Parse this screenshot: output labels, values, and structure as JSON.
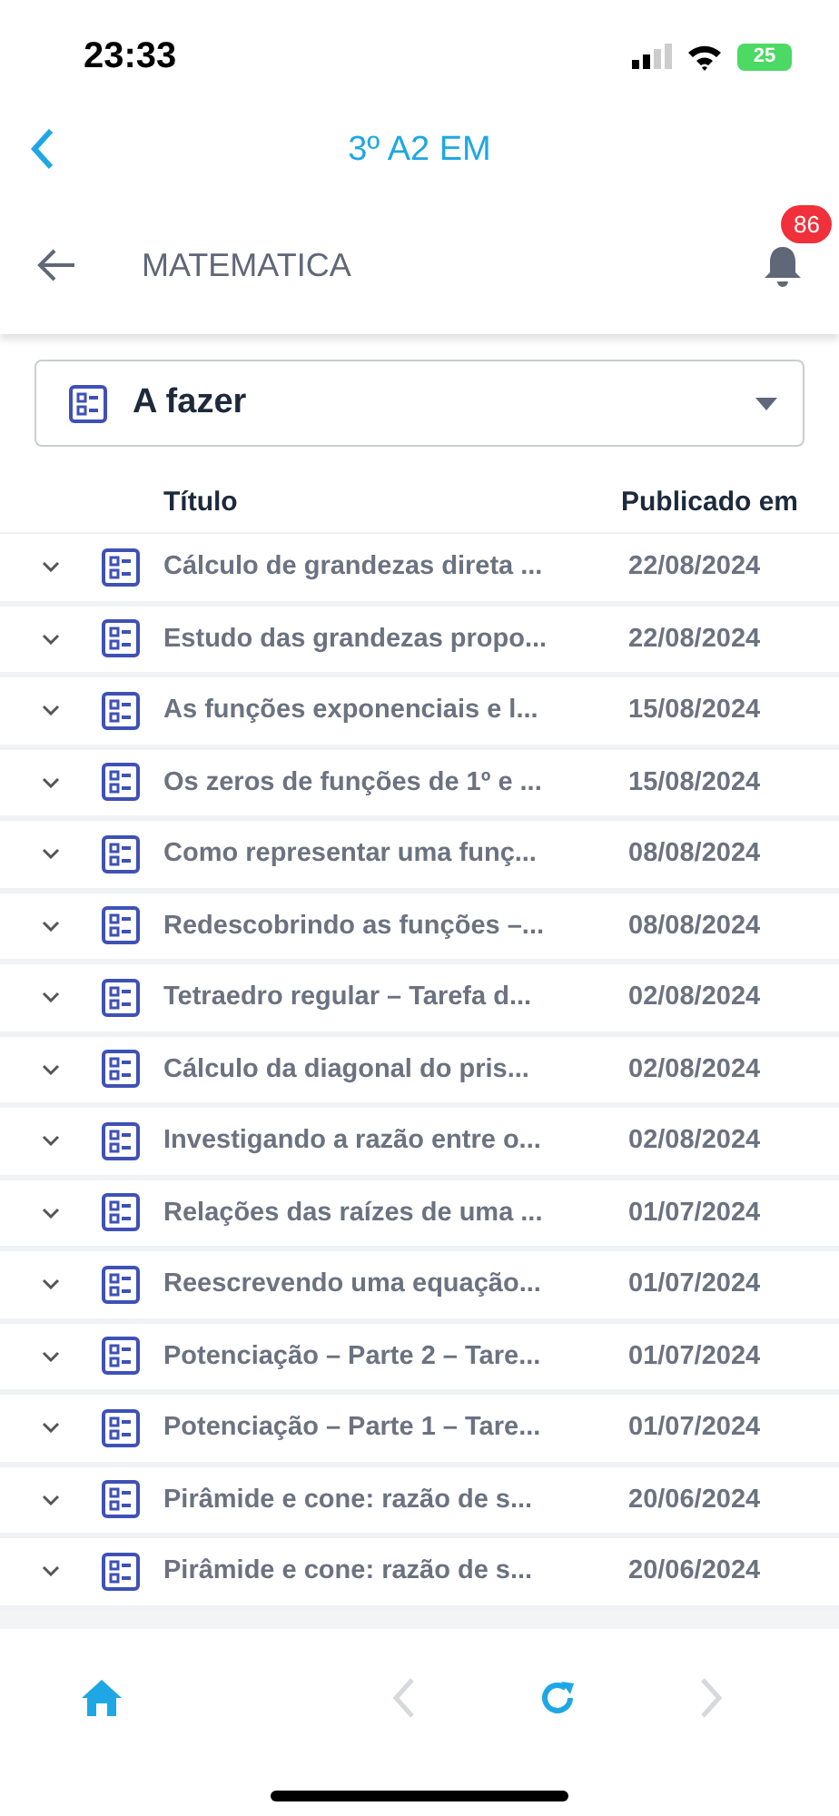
{
  "status_bar": {
    "time": "23:33",
    "battery": "25"
  },
  "top_bar": {
    "title": "3º A2 EM"
  },
  "header": {
    "title": "MATEMATICA",
    "notifications": "86"
  },
  "filter": {
    "value": "A fazer"
  },
  "table": {
    "columns": [
      "Título",
      "Publicado em"
    ],
    "rows": [
      {
        "title": "Cálculo de grandezas direta ...",
        "date": "22/08/2024"
      },
      {
        "title": "Estudo das grandezas propo...",
        "date": "22/08/2024"
      },
      {
        "title": "As funções exponenciais e l...",
        "date": "15/08/2024"
      },
      {
        "title": "Os zeros de funções de 1º e ...",
        "date": "15/08/2024"
      },
      {
        "title": "Como representar uma funç...",
        "date": "08/08/2024"
      },
      {
        "title": "Redescobrindo as funções –...",
        "date": "08/08/2024"
      },
      {
        "title": "Tetraedro regular – Tarefa d...",
        "date": "02/08/2024"
      },
      {
        "title": "Cálculo da diagonal do pris...",
        "date": "02/08/2024"
      },
      {
        "title": "Investigando a razão entre o...",
        "date": "02/08/2024"
      },
      {
        "title": "Relações das raízes de uma ...",
        "date": "01/07/2024"
      },
      {
        "title": "Reescrevendo uma equação...",
        "date": "01/07/2024"
      },
      {
        "title": "Potenciação – Parte 2 – Tare...",
        "date": "01/07/2024"
      },
      {
        "title": "Potenciação – Parte 1 – Tare...",
        "date": "01/07/2024"
      },
      {
        "title": "Pirâmide e cone: razão de s...",
        "date": "20/06/2024"
      },
      {
        "title": "Pirâmide e cone: razão de s...",
        "date": "20/06/2024"
      }
    ]
  },
  "bottom_nav": [
    {
      "kind": "home",
      "disabled": false
    },
    {
      "kind": "back",
      "disabled": true
    },
    {
      "kind": "reload",
      "disabled": false
    },
    {
      "kind": "forward",
      "disabled": true
    }
  ]
}
